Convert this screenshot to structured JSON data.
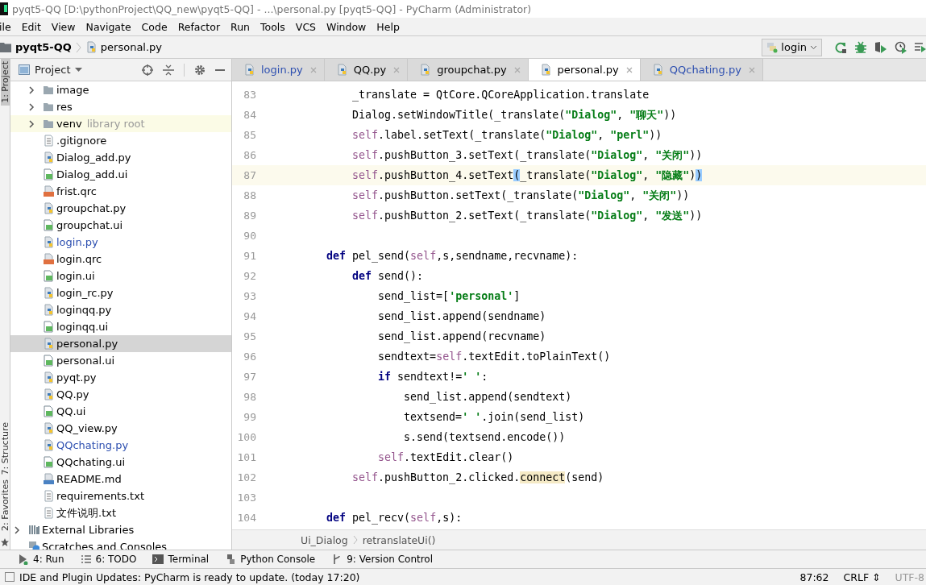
{
  "window": {
    "title": "pyqt5-QQ [D:\\pythonProject\\QQ_new\\pyqt5-QQ] - ...\\personal.py [pyqt5-QQ] - PyCharm (Administrator)"
  },
  "menu": [
    "ile",
    "Edit",
    "View",
    "Navigate",
    "Code",
    "Refactor",
    "Run",
    "Tools",
    "VCS",
    "Window",
    "Help"
  ],
  "nav_path": [
    "pyqt5-QQ",
    "personal.py"
  ],
  "run_config": "login",
  "side_stripe": [
    {
      "label": "1: Project",
      "selected": true
    },
    {
      "label": "7: Structure",
      "selected": false
    },
    {
      "label": "2: Favorites",
      "selected": false
    }
  ],
  "project_panel": {
    "title": "Project",
    "files": [
      {
        "label": "image",
        "kind": "folder",
        "expanded": false
      },
      {
        "label": "res",
        "kind": "folder",
        "expanded": false
      },
      {
        "label": "venv",
        "kind": "folder",
        "expanded": false,
        "note": "library root"
      },
      {
        "label": ".gitignore",
        "kind": "text"
      },
      {
        "label": "Dialog_add.py",
        "kind": "python"
      },
      {
        "label": "Dialog_add.ui",
        "kind": "qt"
      },
      {
        "label": "frist.qrc",
        "kind": "qrc"
      },
      {
        "label": "groupchat.py",
        "kind": "python"
      },
      {
        "label": "groupchat.ui",
        "kind": "qt"
      },
      {
        "label": "login.py",
        "kind": "python",
        "modified": true
      },
      {
        "label": "login.qrc",
        "kind": "qrc"
      },
      {
        "label": "login.ui",
        "kind": "qt"
      },
      {
        "label": "login_rc.py",
        "kind": "python"
      },
      {
        "label": "loginqq.py",
        "kind": "python"
      },
      {
        "label": "loginqq.ui",
        "kind": "qt"
      },
      {
        "label": "personal.py",
        "kind": "python",
        "selected": true
      },
      {
        "label": "personal.ui",
        "kind": "qt"
      },
      {
        "label": "pyqt.py",
        "kind": "python"
      },
      {
        "label": "QQ.py",
        "kind": "python"
      },
      {
        "label": "QQ.ui",
        "kind": "qt"
      },
      {
        "label": "QQ_view.py",
        "kind": "python"
      },
      {
        "label": "QQchating.py",
        "kind": "python",
        "modified": true
      },
      {
        "label": "QQchating.ui",
        "kind": "qt"
      },
      {
        "label": "README.md",
        "kind": "markdown"
      },
      {
        "label": "requirements.txt",
        "kind": "text"
      },
      {
        "label": "文件说明.txt",
        "kind": "text"
      }
    ],
    "top_items": [
      {
        "label": "External Libraries",
        "kind": "libraries",
        "expanded": false
      },
      {
        "label": "Scratches and Consoles",
        "kind": "scratches"
      }
    ]
  },
  "editor_tabs": [
    {
      "label": "login.py",
      "selected": false,
      "modified": true
    },
    {
      "label": "QQ.py",
      "selected": false,
      "modified": false
    },
    {
      "label": "groupchat.py",
      "selected": false,
      "modified": false
    },
    {
      "label": "personal.py",
      "selected": true,
      "modified": false
    },
    {
      "label": "QQchating.py",
      "selected": false,
      "modified": true
    }
  ],
  "code_lines": [
    {
      "children": [
        {
          "number": "83",
          "tokens": [
            {
              "kind": "plain",
              "text": "_translate = QtCore.QCoreApplication.translate"
            }
          ]
        },
        {
          "number": "84",
          "tokens": [
            {
              "kind": "plain",
              "text": "Dialog.setWindowTitle(_translate("
            },
            {
              "kind": "str",
              "text": "\"Dialog\""
            },
            {
              "kind": "plain",
              "text": ", "
            },
            {
              "kind": "str",
              "text": "\"聊天\""
            },
            {
              "kind": "plain",
              "text": "))"
            }
          ]
        },
        {
          "number": "85",
          "tokens": [
            {
              "kind": "self",
              "text": "self"
            },
            {
              "kind": "plain",
              "text": ".label.setText(_translate("
            },
            {
              "kind": "str",
              "text": "\"Dialog\""
            },
            {
              "kind": "plain",
              "text": ", "
            },
            {
              "kind": "str",
              "text": "\"perl\""
            },
            {
              "kind": "plain",
              "text": "))"
            }
          ]
        },
        {
          "number": "86",
          "tokens": [
            {
              "kind": "self",
              "text": "self"
            },
            {
              "kind": "plain",
              "text": ".pushButton_3.setText(_translate("
            },
            {
              "kind": "str",
              "text": "\"Dialog\""
            },
            {
              "kind": "plain",
              "text": ", "
            },
            {
              "kind": "str",
              "text": "\"关闭\""
            },
            {
              "kind": "plain",
              "text": "))"
            }
          ]
        },
        {
          "number": "87",
          "current": true,
          "tokens": [
            {
              "kind": "self",
              "text": "self"
            },
            {
              "kind": "plain",
              "text": ".pushButton_4.setText"
            },
            {
              "kind": "match",
              "text": "("
            },
            {
              "kind": "plain",
              "text": "_translate("
            },
            {
              "kind": "str",
              "text": "\"Dialog\""
            },
            {
              "kind": "plain",
              "text": ", "
            },
            {
              "kind": "str",
              "text": "\"隐藏\""
            },
            {
              "kind": "plain",
              "text": ")"
            },
            {
              "kind": "match",
              "text": ")"
            }
          ]
        },
        {
          "number": "88",
          "tokens": [
            {
              "kind": "self",
              "text": "self"
            },
            {
              "kind": "plain",
              "text": ".pushButton.setText(_translate("
            },
            {
              "kind": "str",
              "text": "\"Dialog\""
            },
            {
              "kind": "plain",
              "text": ", "
            },
            {
              "kind": "str",
              "text": "\"关闭\""
            },
            {
              "kind": "plain",
              "text": "))"
            }
          ]
        },
        {
          "number": "89",
          "tokens": [
            {
              "kind": "self",
              "text": "self"
            },
            {
              "kind": "plain",
              "text": ".pushButton_2.setText(_translate("
            },
            {
              "kind": "str",
              "text": "\"Dialog\""
            },
            {
              "kind": "plain",
              "text": ", "
            },
            {
              "kind": "str",
              "text": "\"发送\""
            },
            {
              "kind": "plain",
              "text": "))"
            }
          ]
        }
      ]
    },
    {
      "number": "90"
    },
    {
      "number": "91",
      "tokens": [
        {
          "kind": "kw",
          "text": "def"
        },
        {
          "kind": "plain",
          "text": " pel_send("
        },
        {
          "kind": "self",
          "text": "self"
        },
        {
          "kind": "plain",
          "text": ",s,sendname,recvname):"
        }
      ],
      "children": [
        {
          "number": "92",
          "tokens": [
            {
              "kind": "kw",
              "text": "def"
            },
            {
              "kind": "plain",
              "text": " send():"
            }
          ],
          "children": [
            {
              "number": "93",
              "tokens": [
                {
                  "kind": "plain",
                  "text": "send_list=["
                },
                {
                  "kind": "str",
                  "text": "'personal'"
                },
                {
                  "kind": "plain",
                  "text": "]"
                }
              ]
            },
            {
              "number": "94",
              "tokens": [
                {
                  "kind": "plain",
                  "text": "send_list.append(sendname)"
                }
              ]
            },
            {
              "number": "95",
              "tokens": [
                {
                  "kind": "plain",
                  "text": "send_list.append(recvname)"
                }
              ]
            },
            {
              "number": "96",
              "tokens": [
                {
                  "kind": "plain",
                  "text": "sendtext="
                },
                {
                  "kind": "self",
                  "text": "self"
                },
                {
                  "kind": "plain",
                  "text": ".textEdit.toPlainText()"
                }
              ]
            },
            {
              "number": "97",
              "tokens": [
                {
                  "kind": "kw",
                  "text": "if"
                },
                {
                  "kind": "plain",
                  "text": " sendtext!="
                },
                {
                  "kind": "str",
                  "text": "' '"
                },
                {
                  "kind": "plain",
                  "text": ":"
                }
              ],
              "children": [
                {
                  "number": "98",
                  "tokens": [
                    {
                      "kind": "plain",
                      "text": "send_list.append(sendtext)"
                    }
                  ]
                },
                {
                  "number": "99",
                  "tokens": [
                    {
                      "kind": "plain",
                      "text": "textsend="
                    },
                    {
                      "kind": "str",
                      "text": "' '"
                    },
                    {
                      "kind": "plain",
                      "text": ".join(send_list)"
                    }
                  ]
                },
                {
                  "number": "100",
                  "tokens": [
                    {
                      "kind": "plain",
                      "text": "s.send(textsend.encode())"
                    }
                  ]
                }
              ]
            },
            {
              "number": "101",
              "tokens": [
                {
                  "kind": "self",
                  "text": "self"
                },
                {
                  "kind": "plain",
                  "text": ".textEdit.clear()"
                }
              ]
            }
          ]
        },
        {
          "number": "102",
          "tokens": [
            {
              "kind": "self",
              "text": "self"
            },
            {
              "kind": "plain",
              "text": ".pushButton_2.clicked."
            },
            {
              "kind": "hl",
              "text": "connect"
            },
            {
              "kind": "plain",
              "text": "(send)"
            }
          ]
        }
      ]
    },
    {
      "number": "103"
    },
    {
      "number": "104",
      "tokens": [
        {
          "kind": "kw",
          "text": "def"
        },
        {
          "kind": "plain",
          "text": " pel_recv("
        },
        {
          "kind": "self",
          "text": "self"
        },
        {
          "kind": "plain",
          "text": ",s):"
        }
      ]
    }
  ],
  "breadcrumbs": [
    "Ui_Dialog",
    "retranslateUi()"
  ],
  "tool_buttons": [
    {
      "label": "4: Run",
      "kind": "run"
    },
    {
      "label": "6: TODO",
      "kind": "todo"
    },
    {
      "label": "Terminal",
      "kind": "terminal"
    },
    {
      "label": "Python Console",
      "kind": "console"
    },
    {
      "label": "9: Version Control",
      "kind": "vcs"
    }
  ],
  "status_bar": {
    "message": "IDE and Plugin Updates: PyCharm is ready to update. (today 17:20)",
    "position": "87:62",
    "line_separator": "CRLF ⇕",
    "encoding": "UTF-8"
  }
}
